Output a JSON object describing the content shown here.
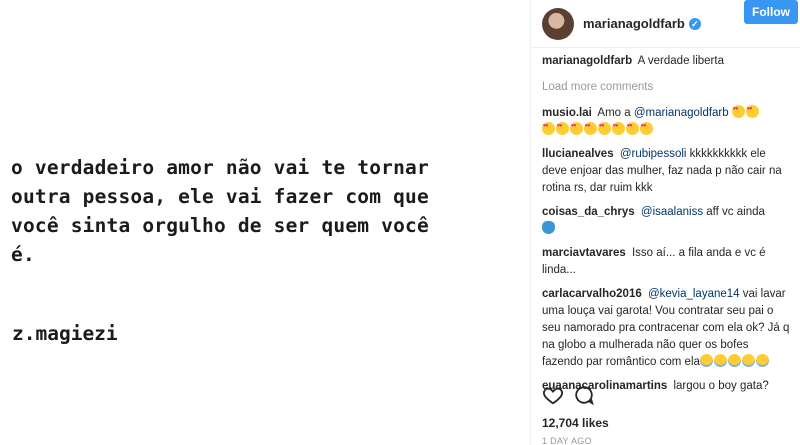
{
  "post": {
    "quote": "o verdadeiro amor não vai te tornar\noutra pessoa, ele vai fazer com que\nvocê sinta orgulho de ser quem você\né.",
    "signature": "z.magiezi"
  },
  "header": {
    "username": "marianagoldfarb",
    "follow_label": "Follow"
  },
  "caption": {
    "user": "marianagoldfarb",
    "text": "A verdade liberta"
  },
  "load_more": "Load more comments",
  "comments": [
    {
      "user": "musio.lai",
      "pre": "Amo a",
      "mention": "@marianagoldfarb",
      "post": ""
    },
    {
      "user": "llucianealves",
      "pre": "",
      "mention": "@rubipessoli",
      "post": "kkkkkkkkkk ele deve enjoar das mulher, faz nada p não cair na rotina rs, dar ruim kkk"
    },
    {
      "user": "coisas_da_chrys",
      "pre": "",
      "mention": "@isaalaniss",
      "post": "aff vc ainda"
    },
    {
      "user": "marciavtavares",
      "pre": "Isso aí... a fila anda e vc é linda...",
      "mention": "",
      "post": ""
    },
    {
      "user": "carlacarvalho2016",
      "pre": "",
      "mention": "@kevia_layane14",
      "post": "vai lavar uma louça vai garota! Vou contratar seu pai o seu namorado pra contracenar com ela ok? Já q na globo a mulherada não quer os bofes fazendo par romântico com ela"
    },
    {
      "user": "euaanacarolinamartins",
      "pre": "largou o boy gata?",
      "mention": "",
      "post": ""
    }
  ],
  "likes": "12,704 likes",
  "time": "1 DAY AGO",
  "colors": {
    "accent": "#3897f0",
    "mention": "#003569"
  }
}
